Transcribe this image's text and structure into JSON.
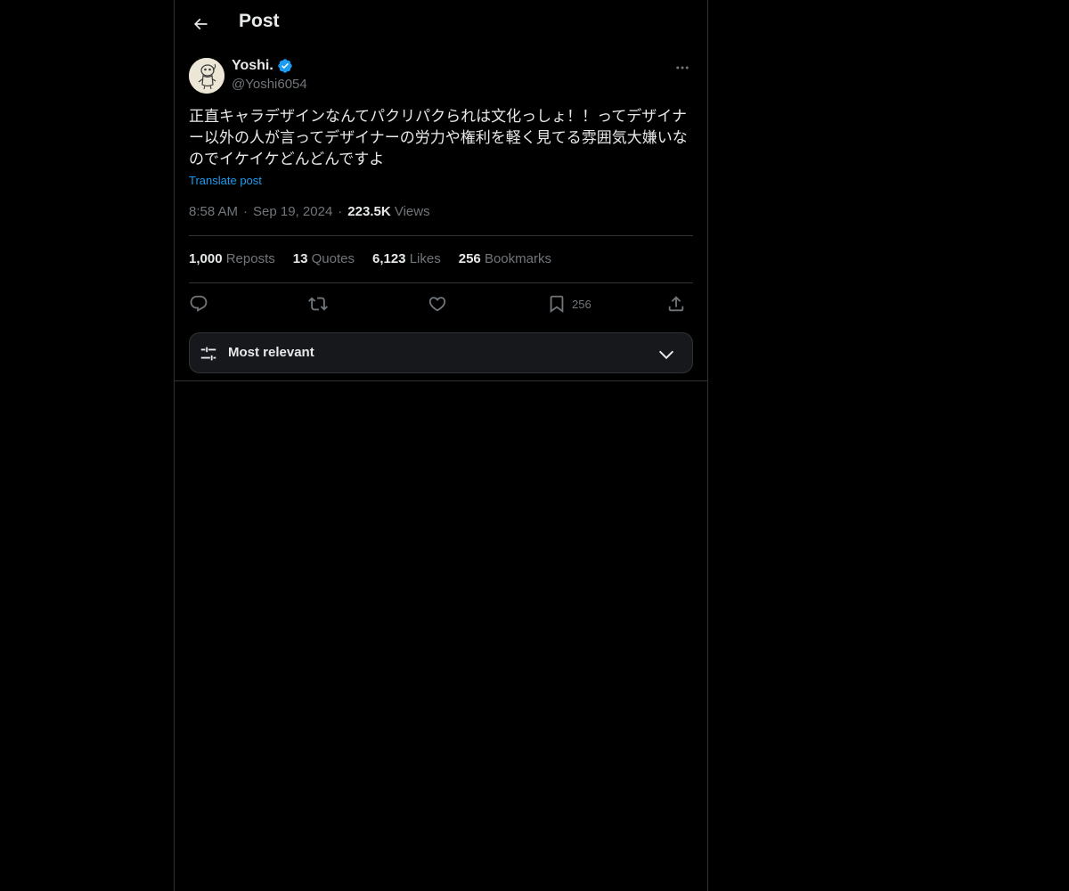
{
  "header": {
    "title": "Post"
  },
  "author": {
    "display_name": "Yoshi.",
    "handle": "@Yoshi6054",
    "verified": true
  },
  "post": {
    "text": "正直キャラデザインなんてパクリパクられは文化っしょ！！ってデザイナー以外の人が言ってデザイナーの労力や権利を軽く見てる雰囲気大嫌いなのでイケイケどんどんですよ",
    "translate_label": "Translate post",
    "time": "8:58 AM",
    "date": "Sep 19, 2024",
    "views_count": "223.5K",
    "views_label": "Views"
  },
  "stats": {
    "reposts_count": "1,000",
    "reposts_label": "Reposts",
    "quotes_count": "13",
    "quotes_label": "Quotes",
    "likes_count": "6,123",
    "likes_label": "Likes",
    "bookmarks_count": "256",
    "bookmarks_label": "Bookmarks"
  },
  "actions": {
    "reply_icon": "reply-icon",
    "repost_icon": "repost-icon",
    "like_icon": "heart-icon",
    "bookmark_icon": "bookmark-icon",
    "bookmark_count": "256",
    "share_icon": "share-icon"
  },
  "sort": {
    "label": "Most relevant"
  },
  "colors": {
    "accent": "#1d9bf0",
    "background": "#000000",
    "muted": "#71767b",
    "border": "#2f3336"
  }
}
